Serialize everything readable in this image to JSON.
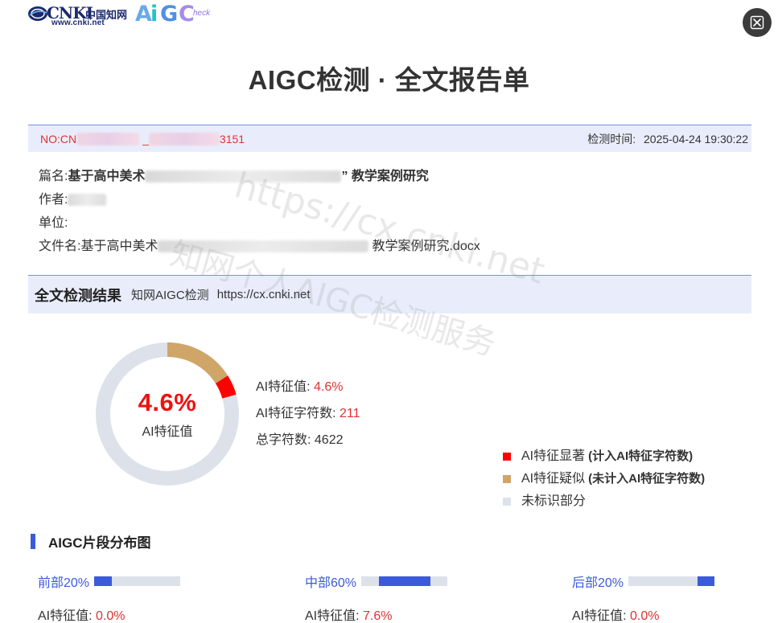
{
  "logo": {
    "cnki_word": "CNKI",
    "cnki_cn": "中国知网",
    "cnki_url": "www.cnki.net",
    "aigc_a": "A",
    "aigc_i": "i",
    "aigc_g": "G",
    "aigc_c": "C",
    "aigc_check": "heck"
  },
  "close_icon": "close-icon",
  "title": "AIGC检测 · 全文报告单",
  "info_bar": {
    "no_prefix": "NO:CN",
    "no_sep": "_",
    "no_suffix": "3151",
    "check_time_label": "检测时间:",
    "check_time_value": "2025-04-24 19:30:22"
  },
  "meta": {
    "title_label": "篇名:",
    "title_start": "基于高中美术",
    "title_end": "” 教学案例研究",
    "author_label": "作者:",
    "unit_label": "单位:",
    "file_label": "文件名:",
    "file_start": "基于高中美术",
    "file_end": "教学案例研究.docx"
  },
  "section": {
    "heading": "全文检测结果",
    "source": "知网AIGC检测",
    "url": "https://cx.cnki.net"
  },
  "result": {
    "percent_text": "4.6%",
    "center_label": "AI特征值",
    "ai_value_label": "AI特征值:",
    "ai_value": "4.6%",
    "ai_chars_label": "AI特征字符数:",
    "ai_chars": "211",
    "total_chars_label": "总字符数:",
    "total_chars": "4622",
    "significant_fraction": 0.046,
    "suspected_fraction": 0.16
  },
  "legend": {
    "significant": "AI特征显著",
    "significant_note": "(计入AI特征字符数)",
    "suspected": "AI特征疑似",
    "suspected_note": "(未计入AI特征字符数)",
    "unmarked": "未标识部分"
  },
  "colors": {
    "significant": "#ff0000",
    "suspected": "#d0a568",
    "unmarked": "#dde2ea",
    "accent": "#3b5bdb"
  },
  "distribution": {
    "title": "AIGC片段分布图",
    "segments": [
      {
        "label": "前部20%",
        "value_label": "AI特征值:",
        "value": "0.0%"
      },
      {
        "label": "中部60%",
        "value_label": "AI特征值:",
        "value": "7.6%"
      },
      {
        "label": "后部20%",
        "value_label": "AI特征值:",
        "value": "0.0%"
      }
    ]
  },
  "watermark": {
    "line1": "https://cx.cnki.net",
    "line2": "知网个人AIGC检测服务"
  }
}
